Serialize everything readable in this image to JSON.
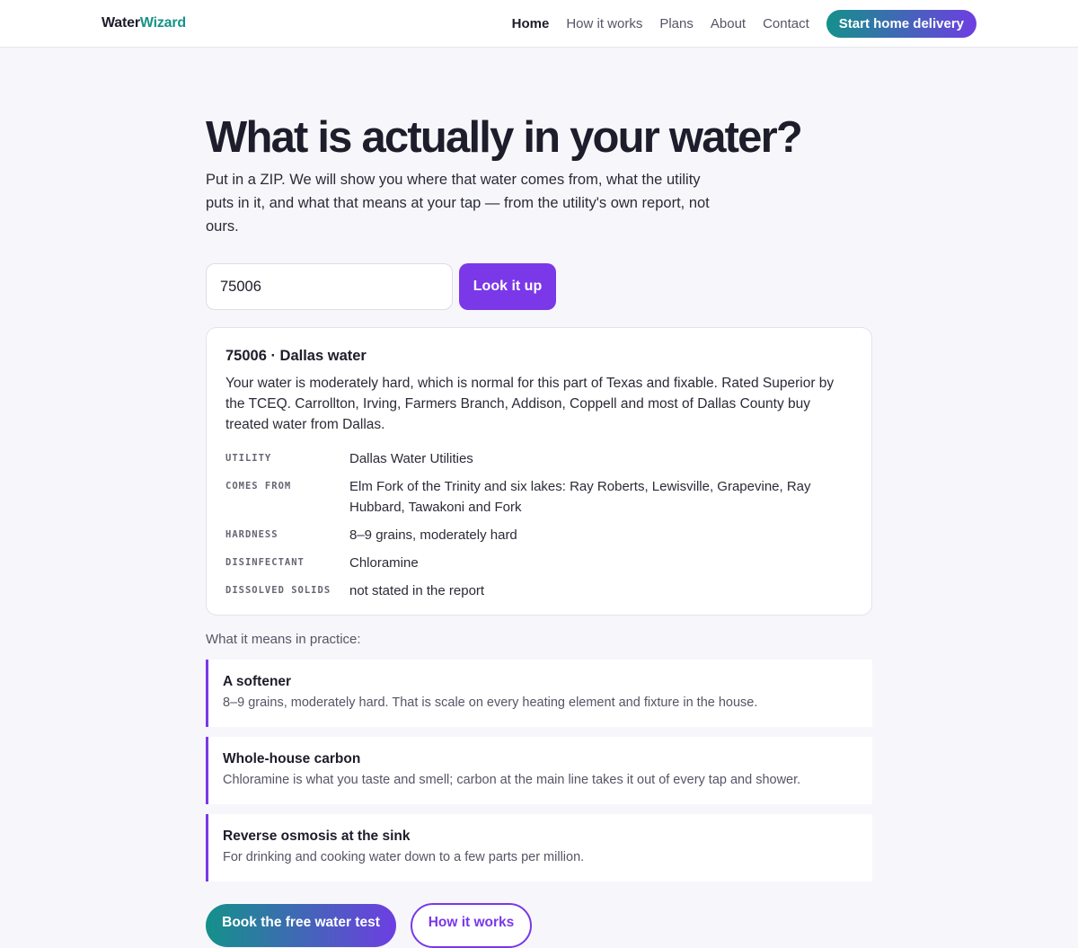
{
  "header": {
    "logo_part1": "Water",
    "logo_part2": "Wizard",
    "nav": [
      {
        "label": "Home",
        "active": true
      },
      {
        "label": "How it works"
      },
      {
        "label": "Plans"
      },
      {
        "label": "About"
      },
      {
        "label": "Contact"
      }
    ],
    "cta_label": "Start home delivery"
  },
  "hero": {
    "title": "What is actually in your water?",
    "subtitle": "Put in a ZIP. We will show you where that water comes from, what the utility puts in it, and what that means at your tap — from the utility's own report, not ours."
  },
  "search": {
    "zip_value": "75006",
    "button_label": "Look it up"
  },
  "result": {
    "title": "75006 · Dallas water",
    "summary": "Your water is moderately hard, which is normal for this part of Texas and fixable. Rated Superior by the TCEQ. Carrollton, Irving, Farmers Branch, Addison, Coppell and most of Dallas County buy treated water from Dallas.",
    "facts": [
      {
        "label": "Utility",
        "value": "Dallas Water Utilities"
      },
      {
        "label": "Comes from",
        "value": "Elm Fork of the Trinity and six lakes: Ray Roberts, Lewisville, Grapevine, Ray Hubbard, Tawakoni and Fork"
      },
      {
        "label": "Hardness",
        "value": "8–9 grains, moderately hard"
      },
      {
        "label": "Disinfectant",
        "value": "Chloramine"
      },
      {
        "label": "Dissolved solids",
        "value": "not stated in the report"
      }
    ]
  },
  "practice": {
    "label": "What it means in practice:",
    "items": [
      {
        "title": "A softener",
        "text": "8–9 grains, moderately hard. That is scale on every heating element and fixture in the house."
      },
      {
        "title": "Whole-house carbon",
        "text": "Chloramine is what you taste and smell; carbon at the main line takes it out of every tap and shower."
      },
      {
        "title": "Reverse osmosis at the sink",
        "text": "For drinking and cooking water down to a few parts per million."
      }
    ]
  },
  "actions": {
    "primary_label": "Book the free water test",
    "secondary_label": "How it works"
  },
  "colors": {
    "teal": "#159488",
    "purple": "#7a38e8"
  }
}
